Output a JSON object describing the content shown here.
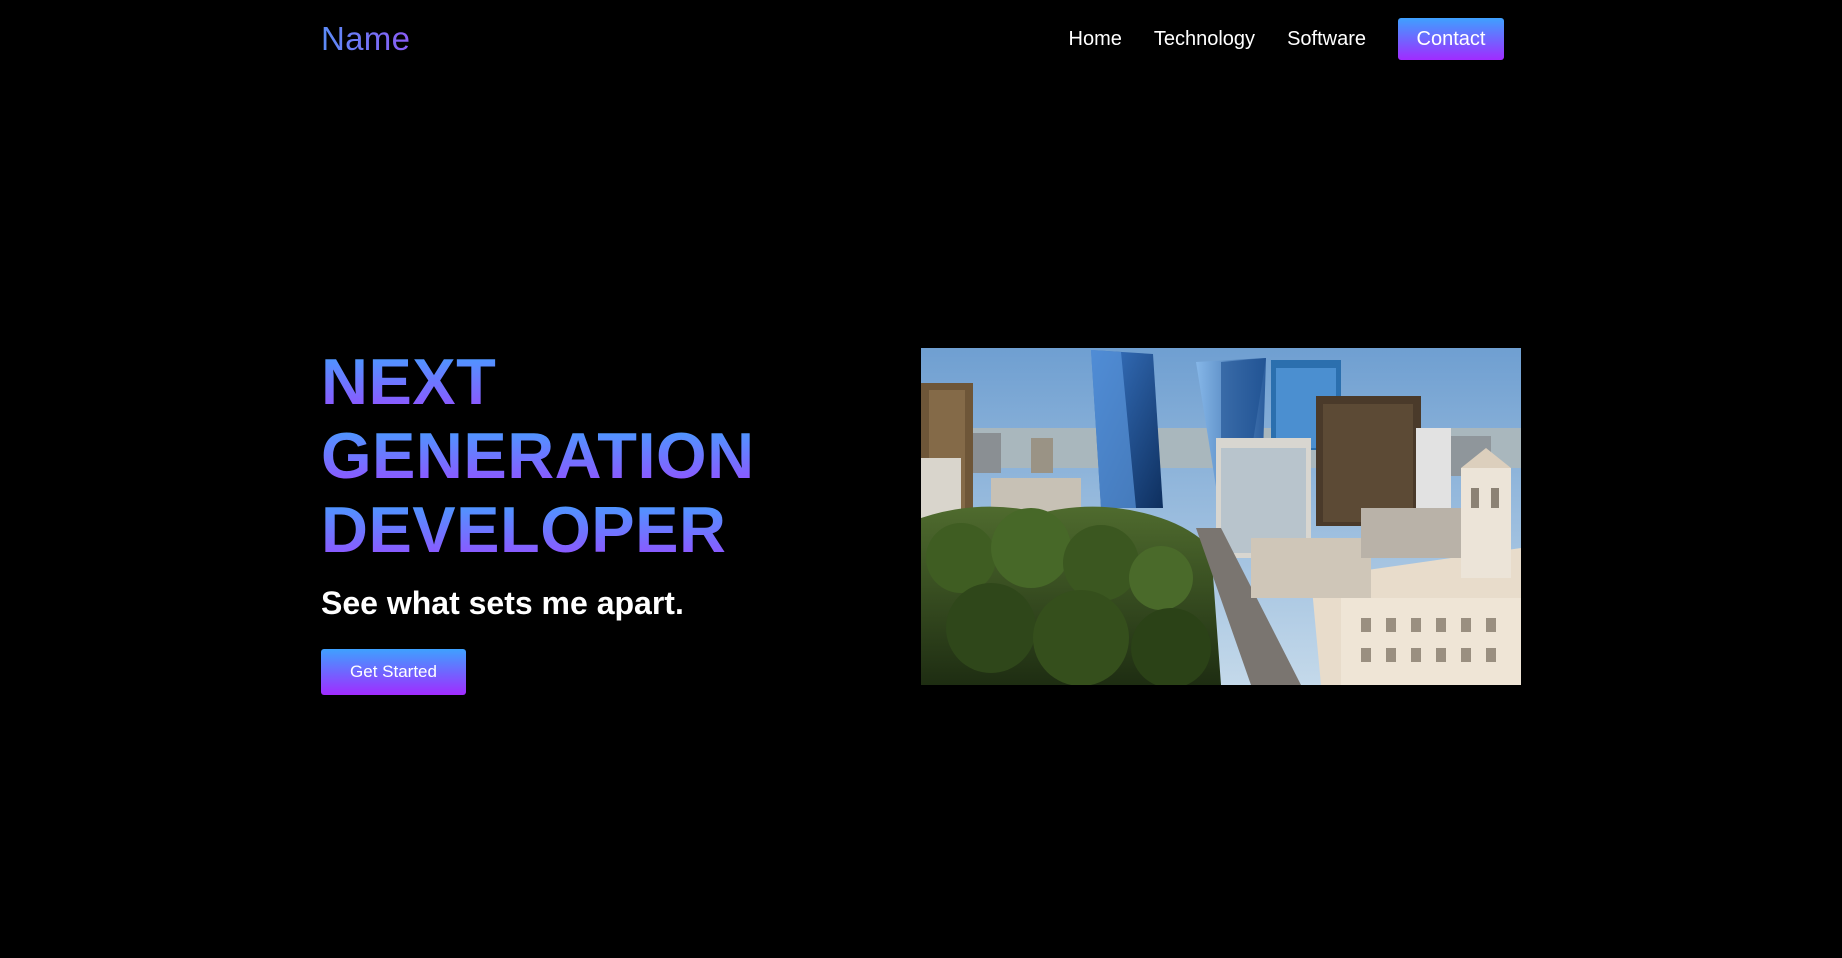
{
  "navbar": {
    "brand": "Name",
    "links": [
      "Home",
      "Technology",
      "Software"
    ],
    "contact_label": "Contact"
  },
  "hero": {
    "headline": [
      "NEXT",
      "GENERATION",
      "DEVELOPER"
    ],
    "tagline": "See what sets me apart.",
    "cta_label": "Get Started"
  },
  "image": {
    "subject": "aerial view of a downtown city skyline with park"
  },
  "colors": {
    "background": "#000000",
    "gradient_start": "#3ea1ff",
    "gradient_end": "#a12bff",
    "text": "#ffffff"
  }
}
